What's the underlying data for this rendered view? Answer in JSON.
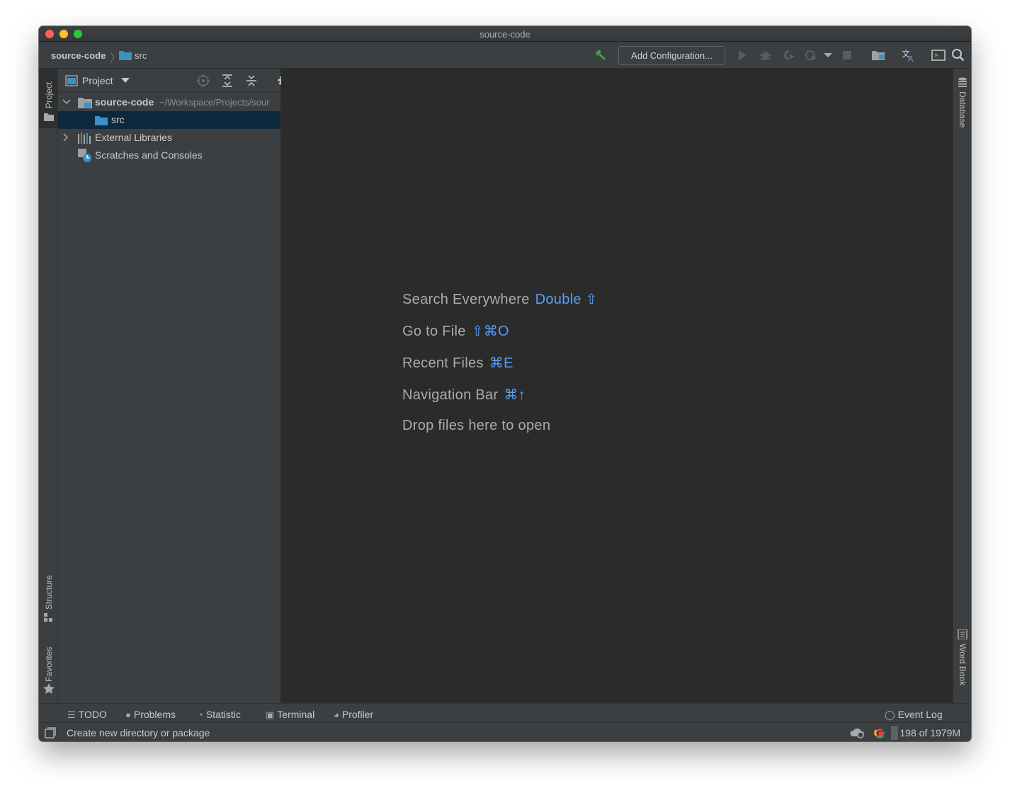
{
  "window": {
    "title": "source-code"
  },
  "navbar": {
    "breadcrumb_root": "source-code",
    "breadcrumb_child": "src",
    "add_configuration_label": "Add Configuration..."
  },
  "left_stripe": {
    "project_label": "Project",
    "structure_label": "Structure",
    "favorites_label": "Favorites"
  },
  "right_stripe": {
    "database_label": "Database",
    "wordbook_label": "Word Book"
  },
  "project_panel": {
    "view_label": "Project",
    "tree": [
      {
        "label": "source-code",
        "path": "~/Workspace/Projects/sour"
      },
      {
        "label": "src"
      },
      {
        "label": "External Libraries"
      },
      {
        "label": "Scratches and Consoles"
      }
    ]
  },
  "editor": {
    "hints": [
      {
        "label": "Search Everywhere",
        "shortcut": "Double ⇧"
      },
      {
        "label": "Go to File",
        "shortcut": "⇧⌘O"
      },
      {
        "label": "Recent Files",
        "shortcut": "⌘E"
      },
      {
        "label": "Navigation Bar",
        "shortcut": "⌘↑"
      },
      {
        "label": "Drop files here to open",
        "shortcut": ""
      }
    ]
  },
  "bottom_tools": {
    "todo": "TODO",
    "problems": "Problems",
    "statistic": "Statistic",
    "terminal": "Terminal",
    "profiler": "Profiler",
    "event_log": "Event Log"
  },
  "statusbar": {
    "message": "Create new directory or package",
    "memory": "198 of 1979M",
    "memory_used_fraction": 0.1
  },
  "colors": {
    "accent_blue": "#589df6",
    "selection": "#0d293e",
    "run_green": "#499c54",
    "folder_blue": "#3d8fc7"
  }
}
